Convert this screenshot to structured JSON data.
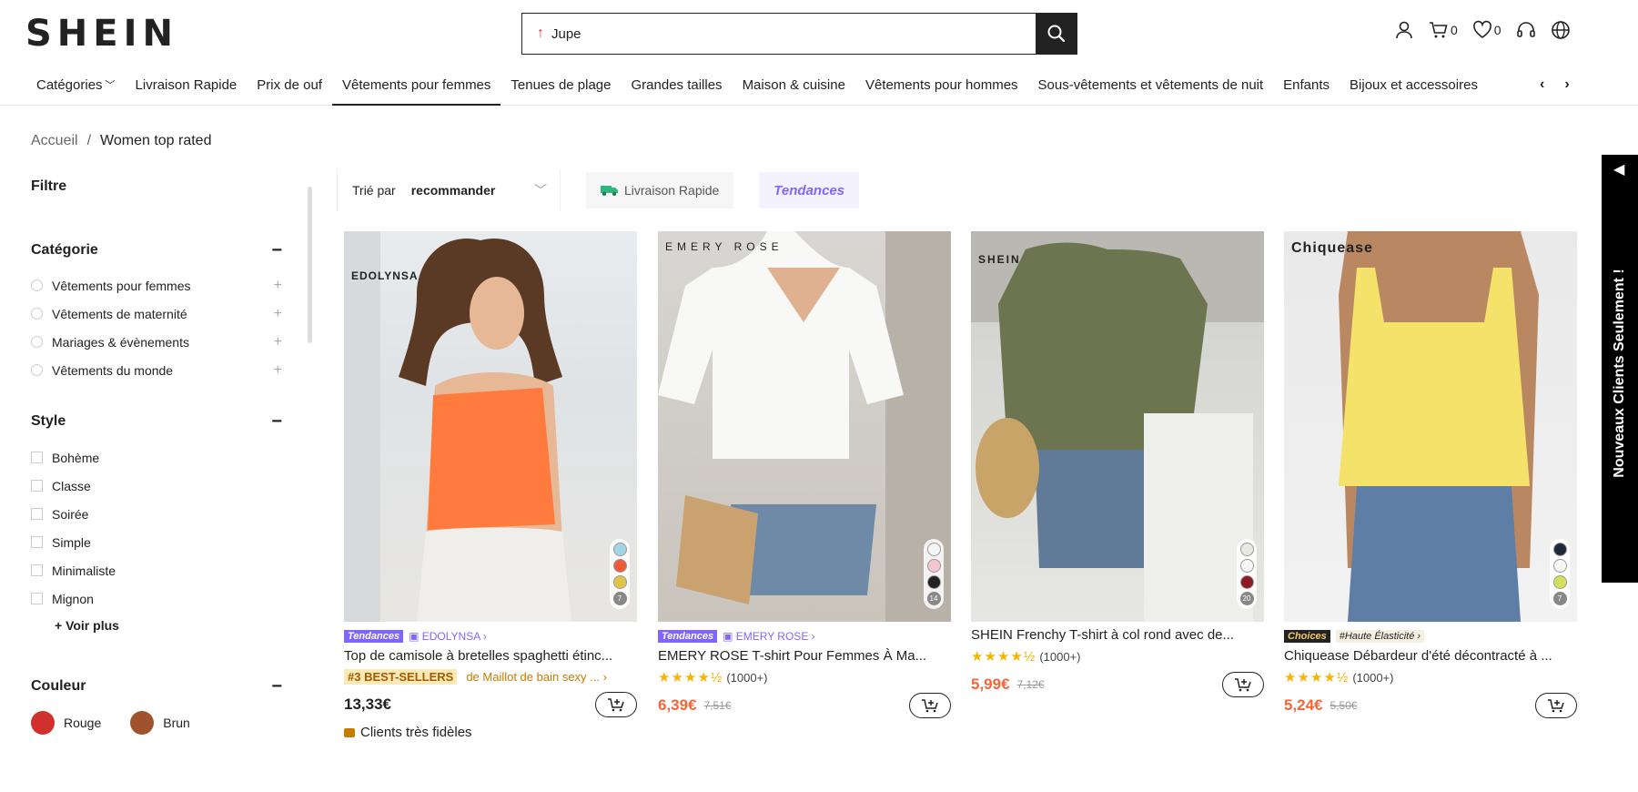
{
  "header": {
    "logo": "SHEIN",
    "search_value": "Jupe",
    "cart_count": "0",
    "wish_count": "0"
  },
  "nav": {
    "items": [
      "Catégories",
      "Livraison Rapide",
      "Prix de ouf",
      "Vêtements pour femmes",
      "Tenues de plage",
      "Grandes tailles",
      "Maison & cuisine",
      "Vêtements pour hommes",
      "Sous-vêtements et vêtements de nuit",
      "Enfants",
      "Bijoux et accessoires"
    ],
    "active": "Vêtements pour femmes"
  },
  "breadcrumb": {
    "home": "Accueil",
    "sep": "/",
    "current": "Women top rated"
  },
  "filter": {
    "title": "Filtre",
    "category_title": "Catégorie",
    "categories": [
      "Vêtements pour femmes",
      "Vêtements de maternité",
      "Mariages & évènements",
      "Vêtements du monde"
    ],
    "style_title": "Style",
    "styles": [
      "Bohème",
      "Classe",
      "Soirée",
      "Simple",
      "Minimaliste",
      "Mignon"
    ],
    "see_more": "+ Voir plus",
    "color_title": "Couleur",
    "colors": [
      {
        "name": "Rouge",
        "hex": "#d0312d"
      },
      {
        "name": "Brun",
        "hex": "#a0522d"
      }
    ]
  },
  "toolbar": {
    "sort_label": "Trié par",
    "sort_value": "recommander",
    "chip_fast": "Livraison Rapide",
    "chip_trend": "Tendances"
  },
  "products": [
    {
      "brand": "EDOLYNSA",
      "tag": "Tendances",
      "store": "EDOLYNSA",
      "title": "Top de camisole à bretelles spaghetti étinc...",
      "best_badge": "#3 BEST-SELLERS",
      "best_text": "de Maillot de bain sexy ...",
      "price": "13,33€",
      "loyal": "Clients très fidèles",
      "colors": [
        "#a5d3e8",
        "#f05a3a",
        "#e0c44a"
      ],
      "color_count": "7"
    },
    {
      "brand": "EMERY ROSE",
      "tag": "Tendances",
      "store": "EMERY ROSE",
      "title": "EMERY ROSE T-shirt Pour Femmes À Ma...",
      "reviews": "(1000+)",
      "rating": "4.5",
      "price": "6,39€",
      "old": "7,51€",
      "colors": [
        "#f5f5f5",
        "#f5c6d0",
        "#222222"
      ],
      "color_count": "14"
    },
    {
      "brand": "SHEIN",
      "title": "SHEIN Frenchy T-shirt à col rond avec de...",
      "reviews": "(1000+)",
      "rating": "4.5",
      "price": "5,99€",
      "old": "7,12€",
      "colors": [
        "#e8e8e0",
        "#f5f5f5",
        "#8b1a24"
      ],
      "color_count": "20"
    },
    {
      "brand": "Chiquease",
      "tag": "Choices",
      "feature": "#Haute Élasticité",
      "title": "Chiquease Débardeur d'été décontracté à ...",
      "reviews": "(1000+)",
      "rating": "4.5",
      "price": "5,24€",
      "old": "5,50€",
      "colors": [
        "#1e2a3a",
        "#f5f5f5",
        "#d4e05a"
      ],
      "color_count": "7"
    }
  ],
  "side_tab": "Nouveaux Clients Seulement !"
}
